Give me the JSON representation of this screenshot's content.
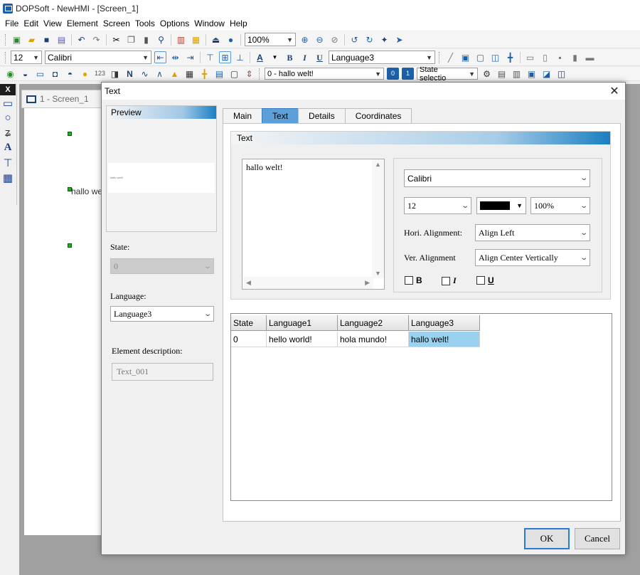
{
  "app": {
    "title": "DOPSoft - NewHMI - [Screen_1]"
  },
  "menu": [
    "File",
    "Edit",
    "View",
    "Element",
    "Screen",
    "Tools",
    "Options",
    "Window",
    "Help"
  ],
  "toolbar": {
    "zoom": "100%",
    "font_size": "12",
    "font_name": "Calibri",
    "language": "Language3",
    "state_text": "0 - hallo welt!",
    "state_select": "State selectio"
  },
  "workspace": {
    "screen_tab": "1 - Screen_1",
    "canvas_text": "hallo wel"
  },
  "dialog": {
    "title": "Text",
    "preview_label": "Preview",
    "preview_mini": "hallo welt!",
    "state_label": "State:",
    "state_value": "0",
    "language_label": "Language:",
    "language_value": "Language3",
    "desc_label": "Element description:",
    "desc_value": "Text_001",
    "tabs": [
      "Main",
      "Text",
      "Details",
      "Coordinates"
    ],
    "text_group_label": "Text",
    "text_content": "hallo welt!",
    "font_name": "Calibri",
    "font_size": "12",
    "scale": "100%",
    "hori_label": "Hori. Alignment:",
    "hori_value": "Align Left",
    "vert_label": "Ver. Alignment",
    "vert_value": "Align Center Vertically",
    "bold_label": "B",
    "italic_label": "I",
    "underline_label": "U",
    "grid": {
      "headers": [
        "State",
        "Language1",
        "Language2",
        "Language3"
      ],
      "rows": [
        [
          "0",
          "hello world!",
          "hola mundo!",
          "hallo welt!"
        ]
      ]
    },
    "ok": "OK",
    "cancel": "Cancel"
  },
  "colors": {
    "accent": "#5d9fd8",
    "selection": "#99d1ef",
    "text_color": "#000000"
  }
}
